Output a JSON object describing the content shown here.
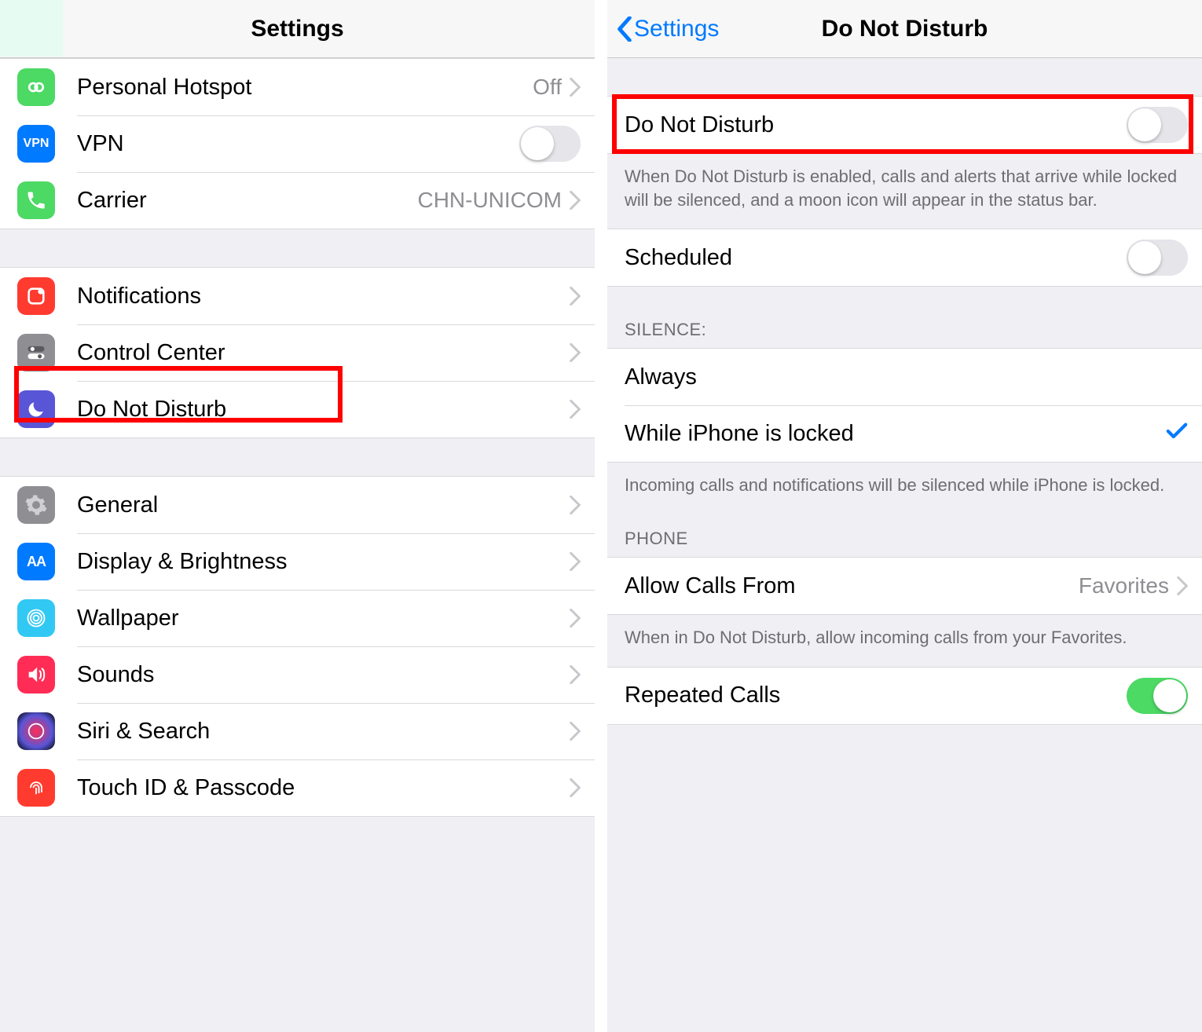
{
  "left": {
    "title": "Settings",
    "group1": {
      "hotspot": {
        "label": "Personal Hotspot",
        "value": "Off"
      },
      "vpn": {
        "label": "VPN"
      },
      "carrier": {
        "label": "Carrier",
        "value": "CHN-UNICOM"
      }
    },
    "group2": {
      "notifications": {
        "label": "Notifications"
      },
      "control_center": {
        "label": "Control Center"
      },
      "dnd": {
        "label": "Do Not Disturb"
      }
    },
    "group3": {
      "general": {
        "label": "General"
      },
      "display": {
        "label": "Display & Brightness"
      },
      "wallpaper": {
        "label": "Wallpaper"
      },
      "sounds": {
        "label": "Sounds"
      },
      "siri": {
        "label": "Siri & Search"
      },
      "touchid": {
        "label": "Touch ID & Passcode"
      }
    }
  },
  "right": {
    "back": "Settings",
    "title": "Do Not Disturb",
    "dnd_row": {
      "label": "Do Not Disturb"
    },
    "dnd_footer": "When Do Not Disturb is enabled, calls and alerts that arrive while locked will be silenced, and a moon icon will appear in the status bar.",
    "scheduled": {
      "label": "Scheduled"
    },
    "silence_header": "SILENCE:",
    "silence_always": "Always",
    "silence_locked": "While iPhone is locked",
    "silence_footer": "Incoming calls and notifications will be silenced while iPhone is locked.",
    "phone_header": "PHONE",
    "allow_calls": {
      "label": "Allow Calls From",
      "value": "Favorites"
    },
    "allow_footer": "When in Do Not Disturb, allow incoming calls from your Favorites.",
    "repeated": {
      "label": "Repeated Calls"
    }
  }
}
